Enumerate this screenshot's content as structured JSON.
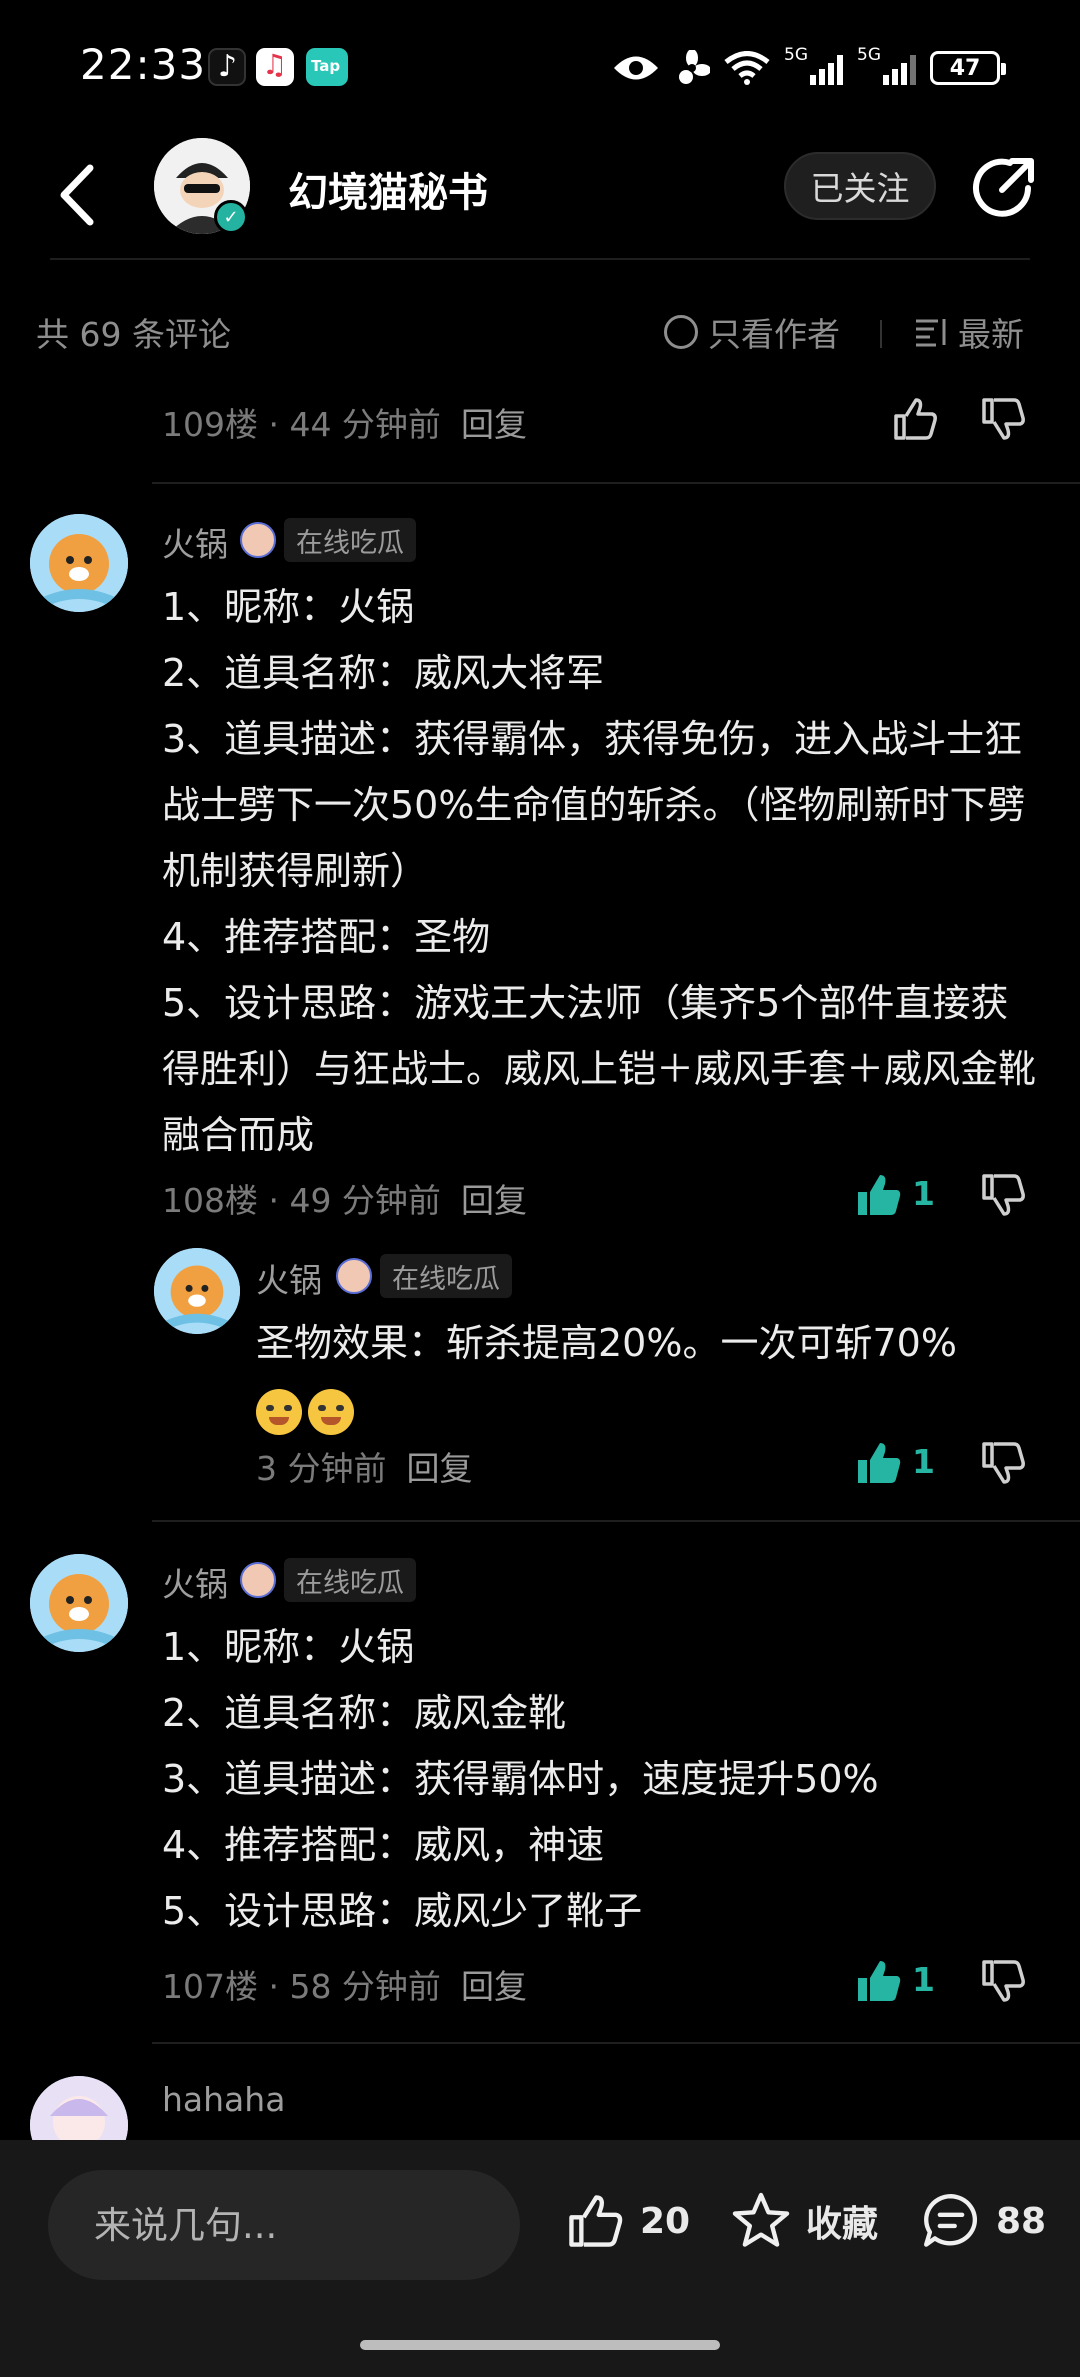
{
  "status_bar": {
    "time": "22:33",
    "network_label_1": "5G",
    "network_label_2": "5G",
    "battery": "47",
    "apps": [
      "tiktok-icon",
      "music-icon",
      "taptap-icon"
    ]
  },
  "header": {
    "author_name": "幻境猫秘书",
    "follow_label": "已关注"
  },
  "comments_bar": {
    "count_label": "共 69 条评论",
    "author_only_label": "只看作者",
    "sort_label": "最新"
  },
  "comments": [
    {
      "meta": "109楼 · 44 分钟前",
      "reply_label": "回复"
    },
    {
      "user": "火锅",
      "badge": "在线吃瓜",
      "lines": [
        "1、昵称：火锅",
        "2、道具名称：威风大将军",
        "3、道具描述：获得霸体，获得免伤，进入战斗士狂战士劈下一次50%生命值的斩杀。（怪物刷新时下劈机制获得刷新）",
        "4、推荐搭配：圣物",
        "5、设计思路：游戏王大法师（集齐5个部件直接获得胜利）与狂战士。威风上铠＋威风手套＋威风金靴融合而成"
      ],
      "meta": "108楼 · 49 分钟前",
      "reply_label": "回复",
      "likes": "1",
      "sub_reply": {
        "user": "火锅",
        "badge": "在线吃瓜",
        "text": "圣物效果：斩杀提高20%。一次可斩70%",
        "meta": "3 分钟前",
        "reply_label": "回复",
        "likes": "1"
      }
    },
    {
      "user": "火锅",
      "badge": "在线吃瓜",
      "lines": [
        "1、昵称：火锅",
        "2、道具名称：威风金靴",
        "3、道具描述：获得霸体时，速度提升50%",
        "4、推荐搭配：威风，神速",
        "5、设计思路：威风少了靴子"
      ],
      "meta": "107楼 · 58 分钟前",
      "reply_label": "回复",
      "likes": "1"
    },
    {
      "user": "hahaha"
    }
  ],
  "bottom_bar": {
    "input_placeholder": "来说几句...",
    "like_count": "20",
    "favorite_label": "收藏",
    "comment_count": "88"
  },
  "colors": {
    "accent": "#26b5a3",
    "background": "#000000",
    "bottom_bar": "#181818"
  }
}
